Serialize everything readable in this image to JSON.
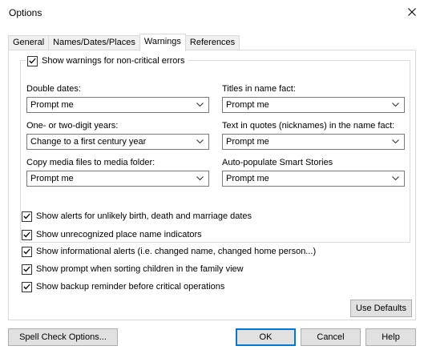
{
  "window": {
    "title": "Options"
  },
  "tabs": [
    "General",
    "Names/Dates/Places",
    "Warnings",
    "References"
  ],
  "warnings": {
    "group_checkbox": {
      "label": "Show warnings for non-critical errors",
      "checked": true
    },
    "fields": {
      "double_dates": {
        "label": "Double dates:",
        "value": "Prompt me"
      },
      "titles_in_name": {
        "label": "Titles in name fact:",
        "value": "Prompt me"
      },
      "two_digit_years": {
        "label": "One- or two-digit years:",
        "value": "Change to a first century year"
      },
      "text_in_quotes": {
        "label": "Text in quotes (nicknames) in the name fact:",
        "value": "Prompt me"
      },
      "copy_media": {
        "label": "Copy media files to media folder:",
        "value": "Prompt me"
      },
      "smart_stories": {
        "label": "Auto-populate Smart Stories",
        "value": "Prompt me"
      }
    },
    "checkboxes": [
      {
        "label": "Show alerts for unlikely birth, death and marriage dates",
        "checked": true
      },
      {
        "label": "Show unrecognized place name indicators",
        "checked": true
      },
      {
        "label": "Show informational alerts (i.e. changed name, changed home person...)",
        "checked": true
      },
      {
        "label": "Show prompt when sorting children in the family view",
        "checked": true
      },
      {
        "label": "Show backup reminder before critical operations",
        "checked": true
      }
    ],
    "use_defaults": "Use Defaults"
  },
  "footer": {
    "spell_check": "Spell Check Options...",
    "ok": "OK",
    "cancel": "Cancel",
    "help": "Help"
  }
}
